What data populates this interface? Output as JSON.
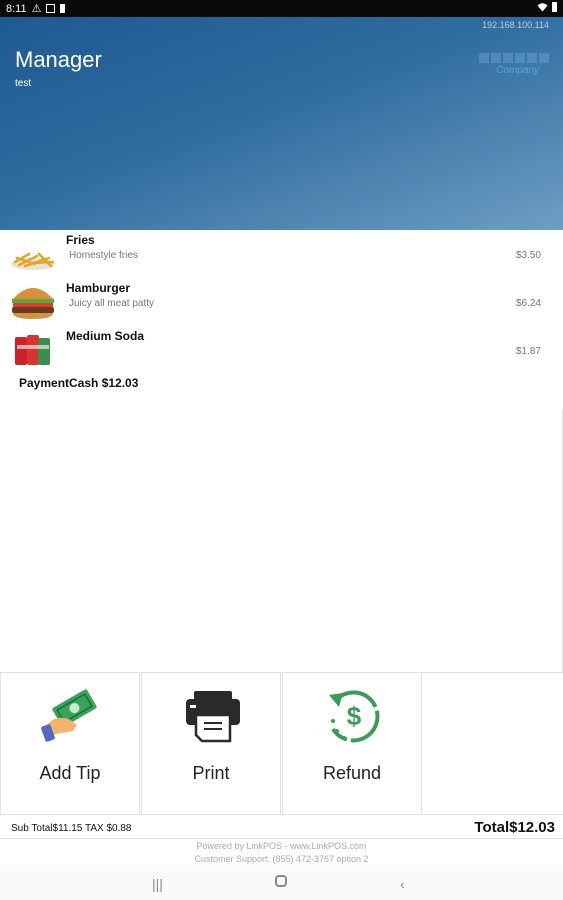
{
  "status_bar": {
    "time": "8:11",
    "icons": [
      "warning-icon",
      "image-icon",
      "battery-icon",
      "wifi-icon"
    ]
  },
  "header": {
    "title": "Manager",
    "subtitle": "test",
    "ip": "192.168.100.114",
    "logo_text": "Company"
  },
  "items": [
    {
      "name": "Fries",
      "description": "Homestyle fries",
      "price": "$3.50",
      "icon": "fries-image"
    },
    {
      "name": "Hamburger",
      "description": "Juicy all meat patty",
      "price": "$6.24",
      "icon": "hamburger-image"
    },
    {
      "name": "Medium Soda",
      "description": "",
      "price": "$1.87",
      "icon": "soda-image"
    }
  ],
  "payment": "PaymentCash $12.03",
  "actions": [
    {
      "label": "Add Tip",
      "icon": "money-hand-icon"
    },
    {
      "label": "Print",
      "icon": "printer-icon"
    },
    {
      "label": "Refund",
      "icon": "refund-icon"
    }
  ],
  "totals": {
    "subtotal": "Sub Total$11.15 TAX $0.88",
    "total": "Total$12.03"
  },
  "footer": {
    "line1": "Powered by LinkPOS - www.LinkPOS.com",
    "line2": "Customer Support: (855) 472-3767 option 2"
  },
  "colors": {
    "header_start": "#1e5a92",
    "header_end": "#6e9ec2",
    "accent_green": "#3d9b5a"
  }
}
